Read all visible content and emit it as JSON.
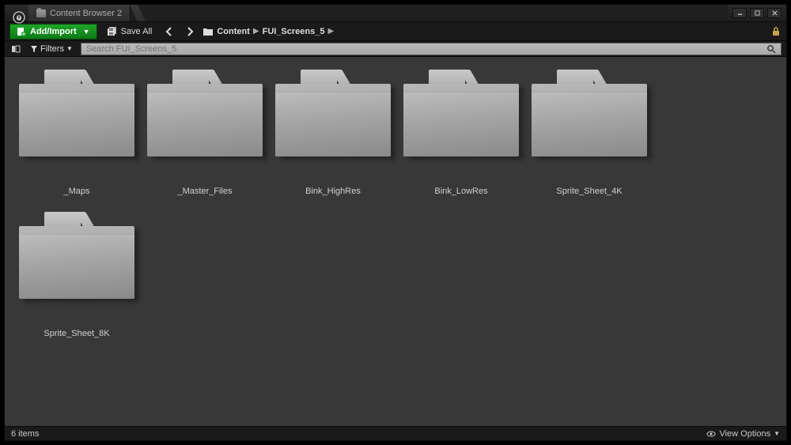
{
  "titlebar": {
    "tab_title": "Content Browser 2"
  },
  "window_controls": {
    "minimize": "minimize",
    "maximize": "maximize",
    "close": "close"
  },
  "toolbar": {
    "add_import_label": "Add/Import",
    "save_all_label": "Save All",
    "breadcrumb": [
      "Content",
      "FUI_Screens_5"
    ]
  },
  "filterbar": {
    "filters_label": "Filters",
    "search_placeholder": "Search FUI_Screens_5"
  },
  "folders": [
    {
      "name": "_Maps"
    },
    {
      "name": "_Master_Files"
    },
    {
      "name": "Bink_HighRes"
    },
    {
      "name": "Bink_LowRes"
    },
    {
      "name": "Sprite_Sheet_4K"
    },
    {
      "name": "Sprite_Sheet_8K"
    }
  ],
  "statusbar": {
    "item_count_label": "6 items",
    "view_options_label": "View Options"
  },
  "colors": {
    "accent_green": "#0b7a15",
    "bg_content": "#383838"
  }
}
